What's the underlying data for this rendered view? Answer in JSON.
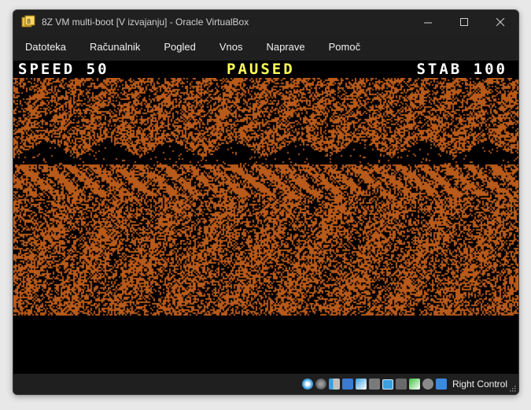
{
  "window": {
    "title": "8Z VM multi-boot [V izvajanju] - Oracle VirtualBox"
  },
  "menu": {
    "items": [
      "Datoteka",
      "Računalnik",
      "Pogled",
      "Vnos",
      "Naprave",
      "Pomoč"
    ]
  },
  "game": {
    "speed_label": "SPEED 50",
    "status_label": "PAUSED",
    "stab_label": "STAB 100",
    "colors": {
      "background": "#000000",
      "terrain": "#b85a1a",
      "hud_text": "#ffffff",
      "paused_text": "#ffff55"
    }
  },
  "statusbar": {
    "icons": [
      "optical-drive-icon",
      "hard-disk-icon",
      "audio-icon",
      "network-icon",
      "usb-icon",
      "shared-folder-icon",
      "display-icon",
      "recording-icon",
      "cpu-icon",
      "mouse-integration-icon",
      "keyboard-icon"
    ],
    "host_key_label": "Right Control"
  }
}
